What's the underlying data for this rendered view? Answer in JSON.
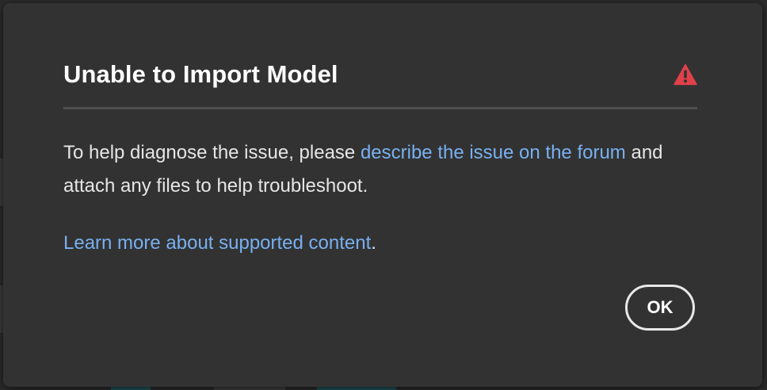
{
  "dialog": {
    "title": "Unable to Import Model",
    "warning_icon": "warning-triangle-icon",
    "body": {
      "text_before_link": "To help diagnose the issue, please ",
      "forum_link": "describe the issue on the forum",
      "text_after_link": " and attach any files to help troubleshoot."
    },
    "learn_more_link": "Learn more about supported content",
    "learn_more_suffix": ".",
    "ok_label": "OK"
  },
  "colors": {
    "dialog_background": "#323232",
    "link": "#78b0f0",
    "warning": "#e0404a",
    "text": "#e6e6e6"
  }
}
